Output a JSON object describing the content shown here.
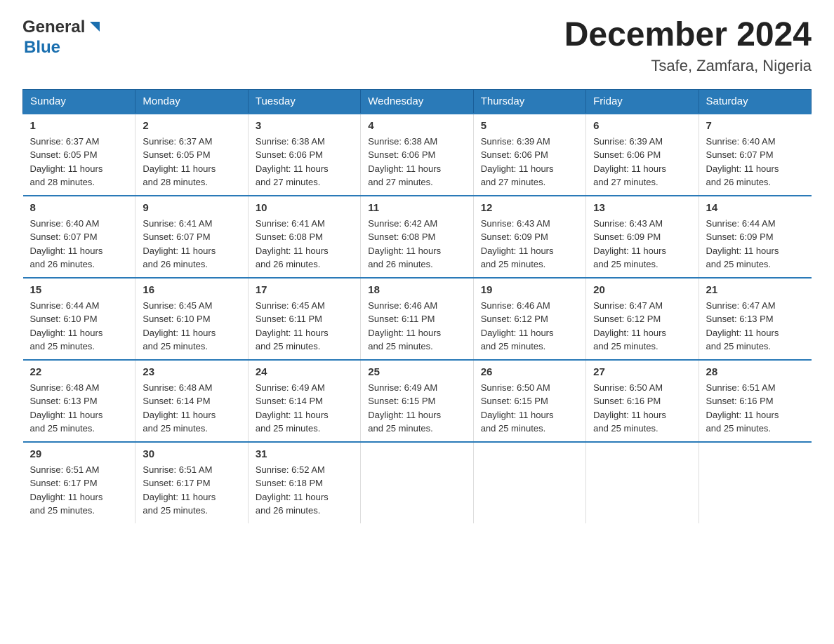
{
  "logo": {
    "text_general": "General",
    "text_blue": "Blue",
    "arrow": "▲"
  },
  "title": {
    "month": "December 2024",
    "location": "Tsafe, Zamfara, Nigeria"
  },
  "days_of_week": [
    "Sunday",
    "Monday",
    "Tuesday",
    "Wednesday",
    "Thursday",
    "Friday",
    "Saturday"
  ],
  "weeks": [
    [
      {
        "day": "1",
        "sunrise": "6:37 AM",
        "sunset": "6:05 PM",
        "daylight": "11 hours and 28 minutes."
      },
      {
        "day": "2",
        "sunrise": "6:37 AM",
        "sunset": "6:05 PM",
        "daylight": "11 hours and 28 minutes."
      },
      {
        "day": "3",
        "sunrise": "6:38 AM",
        "sunset": "6:06 PM",
        "daylight": "11 hours and 27 minutes."
      },
      {
        "day": "4",
        "sunrise": "6:38 AM",
        "sunset": "6:06 PM",
        "daylight": "11 hours and 27 minutes."
      },
      {
        "day": "5",
        "sunrise": "6:39 AM",
        "sunset": "6:06 PM",
        "daylight": "11 hours and 27 minutes."
      },
      {
        "day": "6",
        "sunrise": "6:39 AM",
        "sunset": "6:06 PM",
        "daylight": "11 hours and 27 minutes."
      },
      {
        "day": "7",
        "sunrise": "6:40 AM",
        "sunset": "6:07 PM",
        "daylight": "11 hours and 26 minutes."
      }
    ],
    [
      {
        "day": "8",
        "sunrise": "6:40 AM",
        "sunset": "6:07 PM",
        "daylight": "11 hours and 26 minutes."
      },
      {
        "day": "9",
        "sunrise": "6:41 AM",
        "sunset": "6:07 PM",
        "daylight": "11 hours and 26 minutes."
      },
      {
        "day": "10",
        "sunrise": "6:41 AM",
        "sunset": "6:08 PM",
        "daylight": "11 hours and 26 minutes."
      },
      {
        "day": "11",
        "sunrise": "6:42 AM",
        "sunset": "6:08 PM",
        "daylight": "11 hours and 26 minutes."
      },
      {
        "day": "12",
        "sunrise": "6:43 AM",
        "sunset": "6:09 PM",
        "daylight": "11 hours and 25 minutes."
      },
      {
        "day": "13",
        "sunrise": "6:43 AM",
        "sunset": "6:09 PM",
        "daylight": "11 hours and 25 minutes."
      },
      {
        "day": "14",
        "sunrise": "6:44 AM",
        "sunset": "6:09 PM",
        "daylight": "11 hours and 25 minutes."
      }
    ],
    [
      {
        "day": "15",
        "sunrise": "6:44 AM",
        "sunset": "6:10 PM",
        "daylight": "11 hours and 25 minutes."
      },
      {
        "day": "16",
        "sunrise": "6:45 AM",
        "sunset": "6:10 PM",
        "daylight": "11 hours and 25 minutes."
      },
      {
        "day": "17",
        "sunrise": "6:45 AM",
        "sunset": "6:11 PM",
        "daylight": "11 hours and 25 minutes."
      },
      {
        "day": "18",
        "sunrise": "6:46 AM",
        "sunset": "6:11 PM",
        "daylight": "11 hours and 25 minutes."
      },
      {
        "day": "19",
        "sunrise": "6:46 AM",
        "sunset": "6:12 PM",
        "daylight": "11 hours and 25 minutes."
      },
      {
        "day": "20",
        "sunrise": "6:47 AM",
        "sunset": "6:12 PM",
        "daylight": "11 hours and 25 minutes."
      },
      {
        "day": "21",
        "sunrise": "6:47 AM",
        "sunset": "6:13 PM",
        "daylight": "11 hours and 25 minutes."
      }
    ],
    [
      {
        "day": "22",
        "sunrise": "6:48 AM",
        "sunset": "6:13 PM",
        "daylight": "11 hours and 25 minutes."
      },
      {
        "day": "23",
        "sunrise": "6:48 AM",
        "sunset": "6:14 PM",
        "daylight": "11 hours and 25 minutes."
      },
      {
        "day": "24",
        "sunrise": "6:49 AM",
        "sunset": "6:14 PM",
        "daylight": "11 hours and 25 minutes."
      },
      {
        "day": "25",
        "sunrise": "6:49 AM",
        "sunset": "6:15 PM",
        "daylight": "11 hours and 25 minutes."
      },
      {
        "day": "26",
        "sunrise": "6:50 AM",
        "sunset": "6:15 PM",
        "daylight": "11 hours and 25 minutes."
      },
      {
        "day": "27",
        "sunrise": "6:50 AM",
        "sunset": "6:16 PM",
        "daylight": "11 hours and 25 minutes."
      },
      {
        "day": "28",
        "sunrise": "6:51 AM",
        "sunset": "6:16 PM",
        "daylight": "11 hours and 25 minutes."
      }
    ],
    [
      {
        "day": "29",
        "sunrise": "6:51 AM",
        "sunset": "6:17 PM",
        "daylight": "11 hours and 25 minutes."
      },
      {
        "day": "30",
        "sunrise": "6:51 AM",
        "sunset": "6:17 PM",
        "daylight": "11 hours and 25 minutes."
      },
      {
        "day": "31",
        "sunrise": "6:52 AM",
        "sunset": "6:18 PM",
        "daylight": "11 hours and 26 minutes."
      },
      null,
      null,
      null,
      null
    ]
  ],
  "labels": {
    "sunrise": "Sunrise:",
    "sunset": "Sunset:",
    "daylight": "Daylight:"
  }
}
